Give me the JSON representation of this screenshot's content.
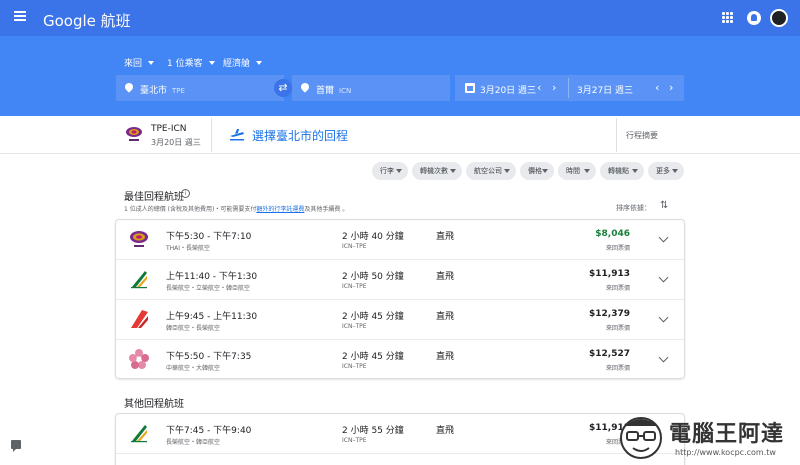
{
  "app": {
    "brand": "Google 航班"
  },
  "search": {
    "trip_type": "來回",
    "passengers": "1 位乘客",
    "cabin": "經濟艙",
    "origin": {
      "city": "臺北市",
      "code": "TPE"
    },
    "destination": {
      "city": "首爾",
      "code": "ICN"
    },
    "depart_date": "3月20日 週三",
    "return_date": "3月27日 週三"
  },
  "step": {
    "leg_code": "TPE-ICN",
    "leg_date": "3月20日 週三",
    "title": "選擇臺北市的回程",
    "summary": "行程摘要"
  },
  "filters": [
    "行李",
    "轉機次數",
    "航空公司",
    "價格",
    "時間",
    "轉機點",
    "更多"
  ],
  "best": {
    "title": "最佳回程航班",
    "note_prefix": "1 位成人的總價 (含稅及其他費用)・可能需要支付",
    "note_link": "額外的行李託運費",
    "note_suffix": "及其他手續費 。",
    "sort_label": "排序依據：",
    "flights": [
      {
        "times": "下午5:30 - 下午7:10",
        "airline": "THAI・長榮航空",
        "duration": "2 小時 40 分鐘",
        "route": "ICN–TPE",
        "stops": "直飛",
        "price": "$8,046",
        "price_note": "來回票價",
        "logo": "thai-logo"
      },
      {
        "times": "上午11:40 - 下午1:30",
        "airline": "長榮航空・立榮航空・韓亞航空",
        "duration": "2 小時 50 分鐘",
        "route": "ICN–TPE",
        "stops": "直飛",
        "price": "$11,913",
        "price_note": "來回票價",
        "logo": "eva-logo"
      },
      {
        "times": "上午9:45 - 上午11:30",
        "airline": "韓亞航空・長榮航空",
        "duration": "2 小時 45 分鐘",
        "route": "ICN–TPE",
        "stops": "直飛",
        "price": "$12,379",
        "price_note": "來回票價",
        "logo": "asiana-logo"
      },
      {
        "times": "下午5:50 - 下午7:35",
        "airline": "中華航空・大韓航空",
        "duration": "2 小時 45 分鐘",
        "route": "ICN–TPE",
        "stops": "直飛",
        "price": "$12,527",
        "price_note": "來回票價",
        "logo": "china-airlines-logo"
      }
    ]
  },
  "other": {
    "title": "其他回程航班",
    "flights": [
      {
        "times": "下午7:45 - 下午9:40",
        "airline": "長榮航空・韓亞航空",
        "duration": "2 小時 55 分鐘",
        "route": "ICN–TPE",
        "stops": "直飛",
        "price": "$11,913",
        "price_note": "來回票價",
        "logo": "eva-logo"
      }
    ]
  },
  "watermark": {
    "text": "電腦王阿達",
    "url": "http://www.kocpc.com.tw"
  },
  "colors": {
    "header": "#3b73e8",
    "search": "#4285f4",
    "accent": "#1a73e8",
    "best_price": "#188038"
  }
}
